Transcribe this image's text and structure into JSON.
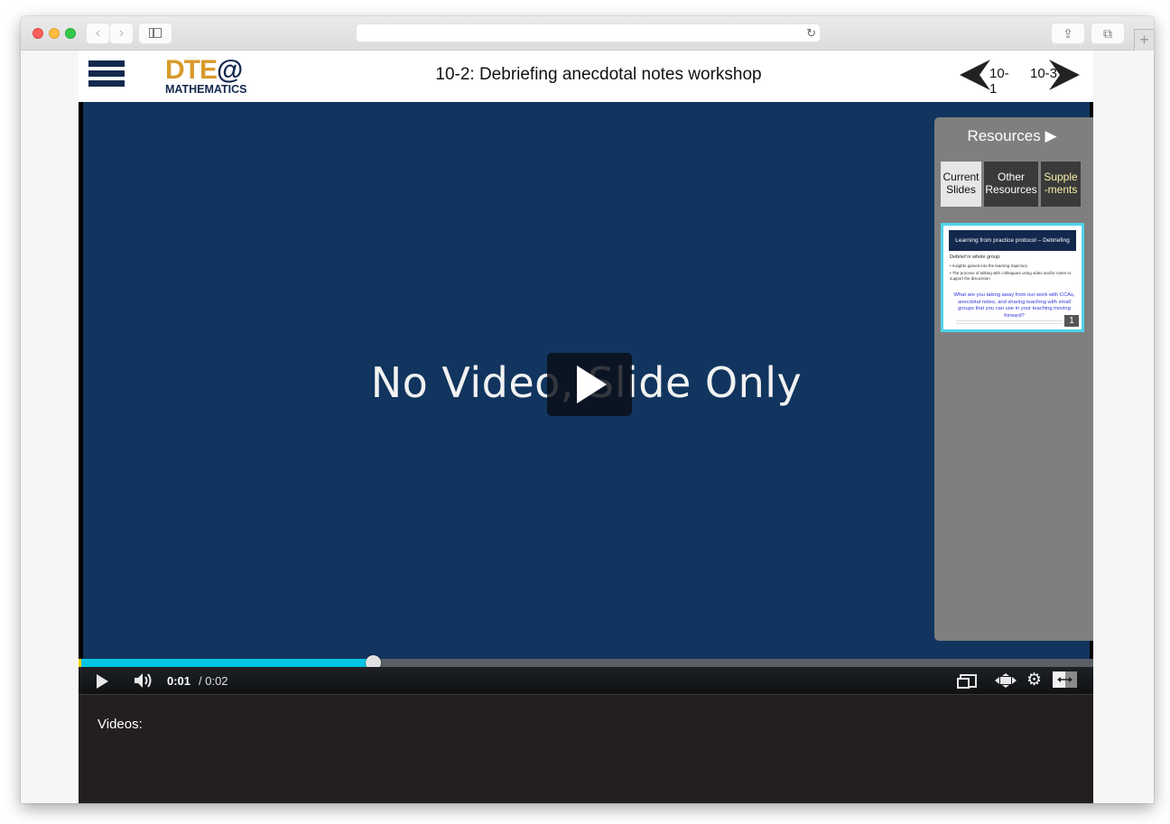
{
  "browser": {
    "traffic_lights": [
      "close",
      "minimize",
      "zoom"
    ],
    "back_icon": "‹",
    "forward_icon": "›",
    "reload_icon": "↻",
    "share_icon": "⇪",
    "tabs_icon": "⧉",
    "new_tab_icon": "+",
    "address_value": ""
  },
  "header": {
    "menu_icon": "hamburger-icon",
    "logo_primary": "DTE",
    "logo_at": "@",
    "logo_secondary": "MATHEMATICS",
    "title": "10-2: Debriefing anecdotal notes workshop",
    "prev_label": "10-1",
    "next_label": "10-3"
  },
  "player": {
    "slide_text": "No Video, Slide Only",
    "current_time": "0:01",
    "duration": "/ 0:02",
    "progress_fraction": 0.29,
    "colors": {
      "video_background": "#11355e",
      "progress_fill": "#00c6e5"
    }
  },
  "resources": {
    "title": "Resources",
    "toggle_icon": "▶",
    "tabs": [
      {
        "line1": "Current",
        "line2": "Slides",
        "active": true
      },
      {
        "line1": "Other",
        "line2": "Resources",
        "active": false
      },
      {
        "line1": "Supple",
        "line2": "-ments",
        "active": false
      }
    ],
    "slide_thumbnail": {
      "heading": "Learning from practice protocol – Debriefing",
      "subheading": "Debrief in whole group:",
      "bullets": [
        "Insights gained into the learning trajectory",
        "The process of talking with colleagues using video and/or notes to support the discussion"
      ],
      "question": "What are you taking away from our work with CCAs, anecdotal notes, and sharing teaching with small groups that you can use in your teaching moving forward?",
      "number": "1"
    }
  },
  "videos": {
    "label": "Videos:"
  }
}
